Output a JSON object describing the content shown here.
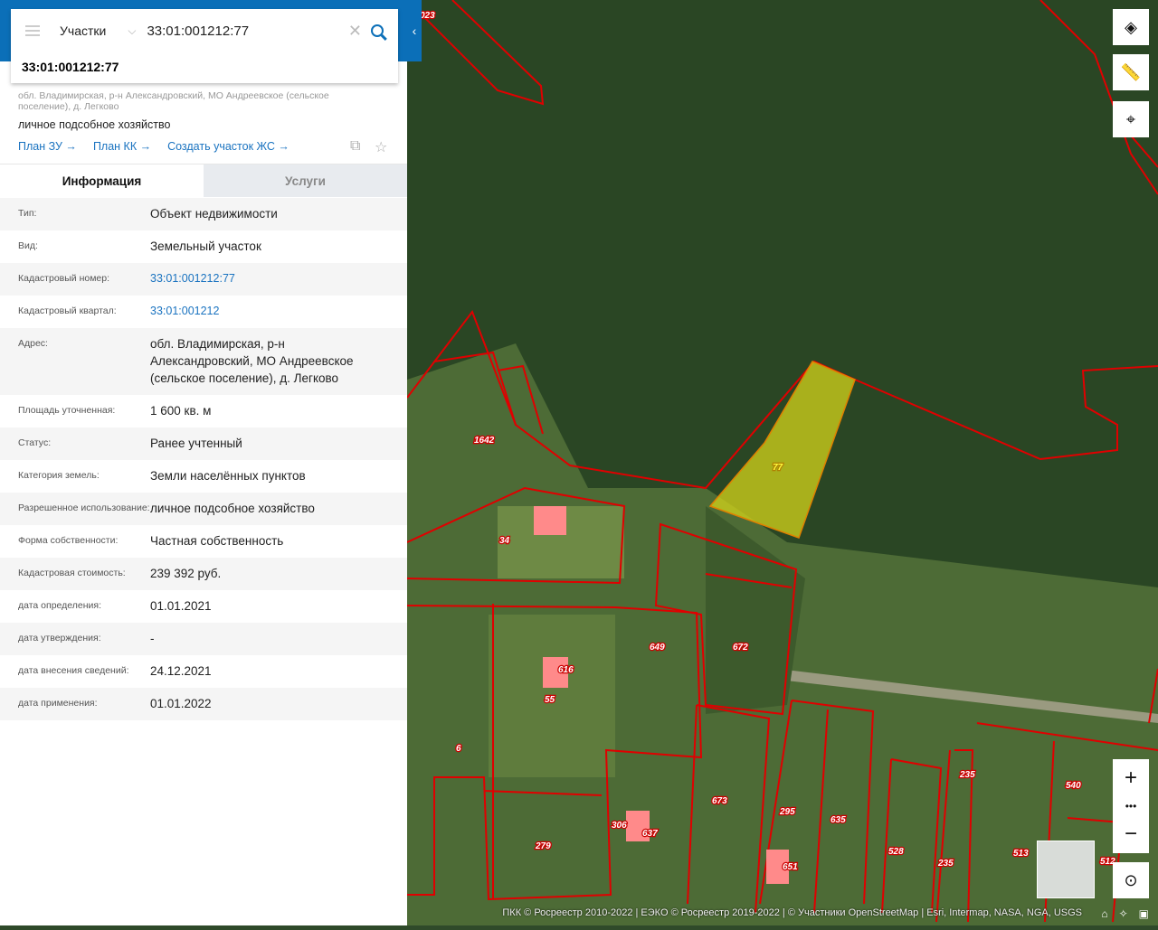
{
  "search": {
    "layer": "Участки",
    "value": "33:01:001212:77",
    "suggestion": "33:01:001212:77"
  },
  "object": {
    "address": "обл. Владимирская, р-н Александровский, МО Андреевское (сельское поселение), д. Легково",
    "use": "личное подсобное хозяйство",
    "links": [
      "План ЗУ →",
      "План КК →",
      "Создать участок ЖС →"
    ]
  },
  "tabs": {
    "info": "Информация",
    "services": "Услуги"
  },
  "rows": [
    {
      "k": "Тип:",
      "v": "Объект недвижимости"
    },
    {
      "k": "Вид:",
      "v": "Земельный участок"
    },
    {
      "k": "Кадастровый номер:",
      "v": "33:01:001212:77",
      "link": true
    },
    {
      "k": "Кадастровый квартал:",
      "v": "33:01:001212",
      "link": true
    },
    {
      "k": "Адрес:",
      "v": "обл. Владимирская, р-н Александровский, МО Андреевское (сельское поселение), д. Легково"
    },
    {
      "k": "Площадь уточненная:",
      "v": "1 600 кв. м"
    },
    {
      "k": "Статус:",
      "v": "Ранее учтенный"
    },
    {
      "k": "Категория земель:",
      "v": "Земли населённых пунктов"
    },
    {
      "k": "Разрешенное использование:",
      "v": "личное подсобное хозяйство"
    },
    {
      "k": "Форма собственности:",
      "v": "Частная собственность"
    },
    {
      "k": "Кадастровая стоимость:",
      "v": "239 392 руб."
    },
    {
      "k": "дата определения:",
      "v": "01.01.2021"
    },
    {
      "k": "дата утверждения:",
      "v": "-"
    },
    {
      "k": "дата внесения сведений:",
      "v": "24.12.2021"
    },
    {
      "k": "дата применения:",
      "v": "01.01.2022"
    }
  ],
  "map": {
    "credits": "ПКК © Росреестр 2010-2022 | ЕЭКО © Росреестр 2019-2022 | © Участники OpenStreetMap | Esri, Intermap, NASA, NGA, USGS",
    "parcel_labels": [
      "023",
      "1642",
      "34",
      "77",
      "649",
      "672",
      "616",
      "55",
      "6",
      "306",
      "637",
      "279",
      "673",
      "295",
      "635",
      "651",
      "528",
      "235",
      "235",
      "513",
      "540",
      "512"
    ],
    "selected_color": "#d4d41a",
    "boundary_color": "#e00000"
  }
}
